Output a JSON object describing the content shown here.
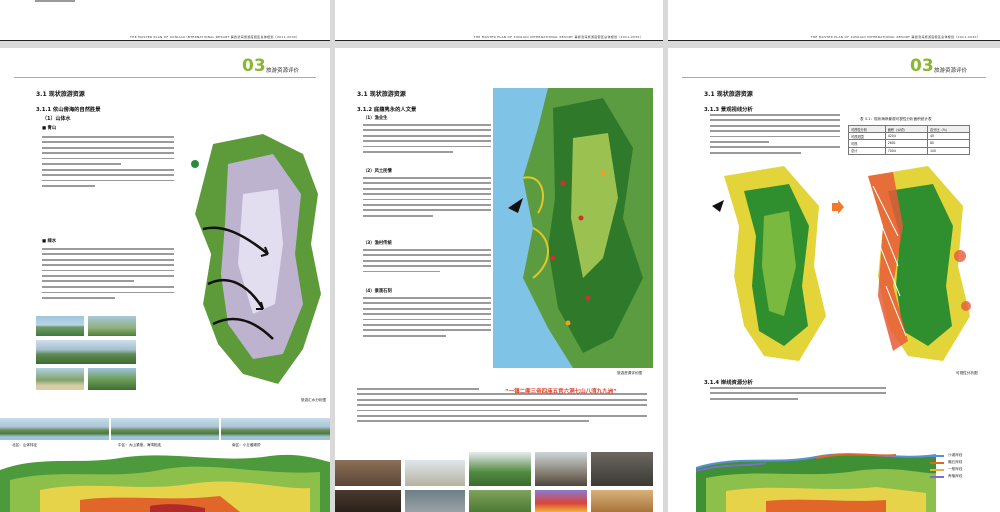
{
  "header": {
    "doc_title": "THE MASTER PLAN OF XUNLIAO INTERNATIONAL RESORT   巽寮滨海旅游度假区总体规划（2011-2030）"
  },
  "chapter": {
    "number": "03",
    "title": "旅游资源评价"
  },
  "page1": {
    "section": "3.1  现状旅游资源",
    "subsection": "3.1.1  依山傍海的自然胜景",
    "sub_item": "（1）山体水",
    "bullet_mountain": "■ 青山",
    "bullet_water": "■ 绿水",
    "map_caption": "旅游汇水分析图",
    "photo_captions": [
      "北区：山体特征",
      "中区：大山紧抱，海湾相连",
      "南区：小丘缓坡阶"
    ]
  },
  "page2": {
    "section": "3.1  现状旅游资源",
    "subsection": "3.1.2  底蕴隽永的人文景",
    "item1": "（1）渔业生",
    "item2": "（2）风土民情",
    "item3": "（3）渔村传统",
    "item4": "（4）景观石刻",
    "map_caption": "旅游资源评价图",
    "highlight": "“一镇二阁三帝四庙五官六洞七山八湾九九洲”"
  },
  "page3": {
    "section": "3.1  现状旅游资源",
    "subsection": "3.1.3  景观视线分析",
    "subsection2": "3.1.4  岸线资源分析",
    "table_title": "表 3.1：现状海岸景观可视性分析面积统计表",
    "table": {
      "headers": [
        "可视性分析",
        "面积（公顷）",
        "百分比（%）"
      ],
      "rows": [
        [
          "可视范围",
          "4204",
          "40"
        ],
        [
          "可视",
          "2801",
          "80"
        ],
        [
          "总计",
          "7004",
          "100"
        ]
      ]
    },
    "map_caption": "可视性分析图",
    "legend": [
      {
        "label": "沙滩岸线",
        "color": "#5a8fd6"
      },
      {
        "label": "礁石岸线",
        "color": "#e0662a"
      },
      {
        "label": "一般岸线",
        "color": "#e8b23a"
      },
      {
        "label": "养殖岸线",
        "color": "#7a6fc8"
      }
    ]
  }
}
